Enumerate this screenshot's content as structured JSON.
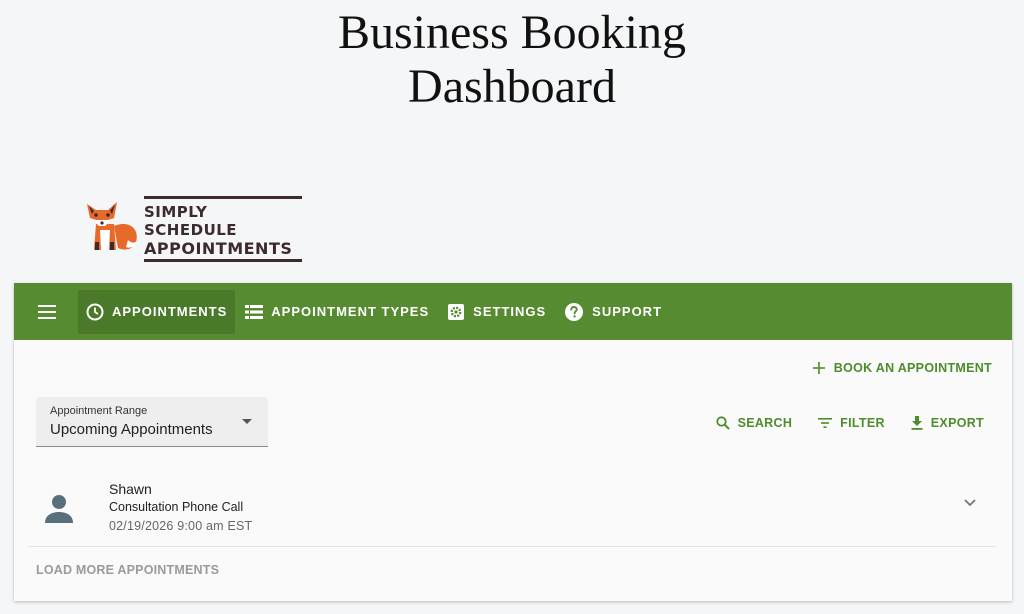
{
  "page": {
    "title_line1": "Business Booking",
    "title_line2": "Dashboard"
  },
  "logo": {
    "line1": "SIMPLY SCHEDULE",
    "line2": "APPOINTMENTS",
    "mascot_icon": "fox-icon"
  },
  "navbar": {
    "background": "#578b31",
    "menu_icon": "hamburger-icon",
    "items": [
      {
        "label": "APPOINTMENTS",
        "icon": "clock-icon",
        "active": true
      },
      {
        "label": "APPOINTMENT TYPES",
        "icon": "list-icon",
        "active": false
      },
      {
        "label": "SETTINGS",
        "icon": "gear-icon",
        "active": false
      },
      {
        "label": "SUPPORT",
        "icon": "help-icon",
        "active": false
      }
    ]
  },
  "toolbar": {
    "book_label": "BOOK AN APPOINTMENT",
    "search_label": "SEARCH",
    "filter_label": "FILTER",
    "export_label": "EXPORT",
    "accent": "#4e8c2c"
  },
  "range_select": {
    "label": "Appointment Range",
    "value": "Upcoming Appointments"
  },
  "appointments": [
    {
      "name": "Shawn",
      "type": "Consultation Phone Call",
      "datetime": "02/19/2026 9:00 am EST",
      "avatar_icon": "person-icon"
    }
  ],
  "load_more_label": "LOAD MORE APPOINTMENTS"
}
